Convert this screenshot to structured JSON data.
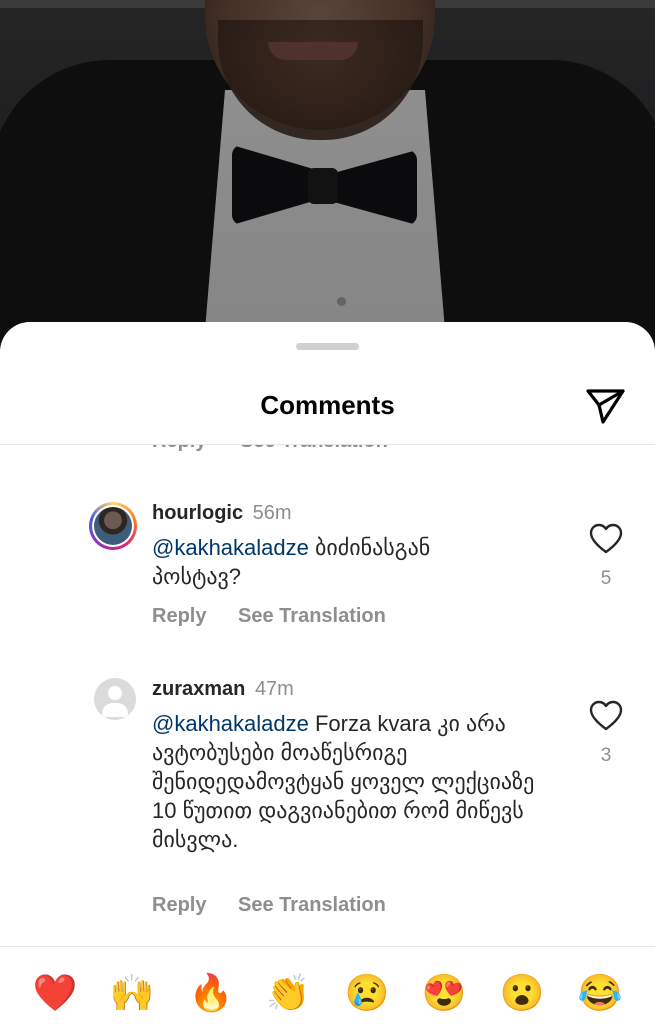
{
  "sheet": {
    "title": "Comments",
    "send_icon": "paper-plane-icon",
    "cut_actions": {
      "reply": "Reply",
      "see_translation": "See Translation"
    }
  },
  "comments": [
    {
      "username": "hourlogic",
      "time": "56m",
      "mention": "@kakhakaladze",
      "text_line1": " ბიძინასგან",
      "text_line2": "პოსტავ?",
      "likes": "5",
      "reply": "Reply",
      "see_translation": "See Translation"
    },
    {
      "username": "zuraxman",
      "time": "47m",
      "mention": "@kakhakaladze",
      "text_rest": " Forza kvara კი არა ავტობუსები მოაწესრიგე შენიდედამოვტყან ყოველ ლექციაზე 10 წუთით დაგვიანებით რომ მიწევს მისვლა.",
      "likes": "3",
      "reply": "Reply",
      "see_translation": "See Translation"
    }
  ],
  "emoji_bar": [
    "❤️",
    "🙌",
    "🔥",
    "👏",
    "😢",
    "😍",
    "😮",
    "😂"
  ],
  "colors": {
    "mention": "#00376b",
    "muted": "#8e8e8e",
    "text": "#262626"
  }
}
